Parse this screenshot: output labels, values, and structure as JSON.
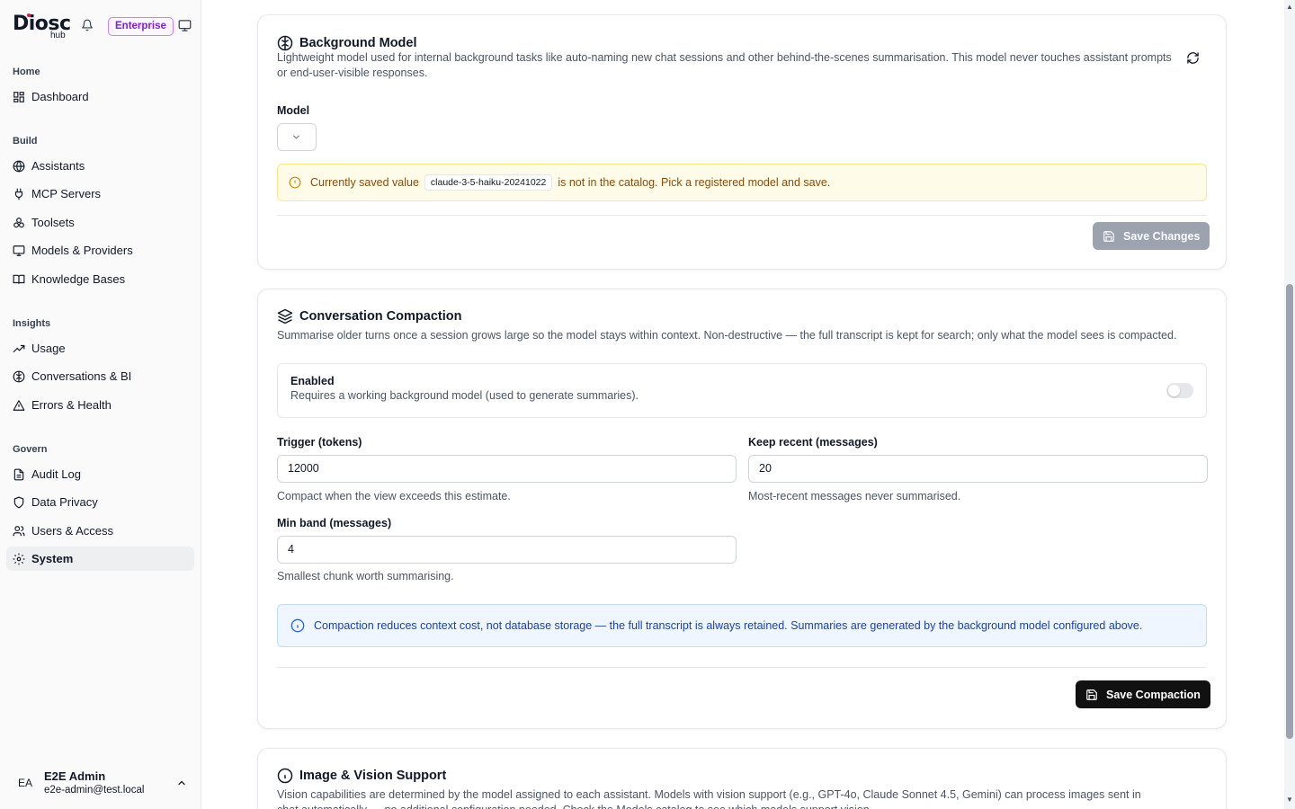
{
  "brand": {
    "name": "Diosc",
    "sub": "hub",
    "badge": "Enterprise"
  },
  "nav": {
    "groups": [
      "Home",
      "Build",
      "Insights",
      "Govern"
    ],
    "items": [
      {
        "label": "Dashboard",
        "icon": "dashboard-icon"
      },
      {
        "label": "Assistants",
        "icon": "globe-icon"
      },
      {
        "label": "MCP Servers",
        "icon": "plug-icon"
      },
      {
        "label": "Toolsets",
        "icon": "tools-icon"
      },
      {
        "label": "Models & Providers",
        "icon": "monitor-icon"
      },
      {
        "label": "Knowledge Bases",
        "icon": "book-icon"
      },
      {
        "label": "Usage",
        "icon": "trend-icon"
      },
      {
        "label": "Conversations & BI",
        "icon": "brain-icon"
      },
      {
        "label": "Errors & Health",
        "icon": "warning-icon"
      },
      {
        "label": "Audit Log",
        "icon": "file-icon"
      },
      {
        "label": "Data Privacy",
        "icon": "shield-icon"
      },
      {
        "label": "Users & Access",
        "icon": "users-icon"
      },
      {
        "label": "System",
        "icon": "gear-icon"
      }
    ]
  },
  "user": {
    "initials": "EA",
    "name": "E2E Admin",
    "email": "e2e-admin@test.local"
  },
  "background_model": {
    "title": "Background Model",
    "description": "Lightweight model used for internal background tasks like auto-naming new chat sessions and other behind-the-scenes summarisation. This model never touches assistant prompts or end-user-visible responses.",
    "model_label": "Model",
    "warning_prefix": "Currently saved value",
    "warning_code": "claude-3-5-haiku-20241022",
    "warning_suffix": "is not in the catalog. Pick a registered model and save.",
    "save_label": "Save Changes"
  },
  "compaction": {
    "title": "Conversation Compaction",
    "description": "Summarise older turns once a session grows large so the model stays within context. Non-destructive — the full transcript is kept for search; only what the model sees is compacted.",
    "enabled_label": "Enabled",
    "enabled_help": "Requires a working background model (used to generate summaries).",
    "enabled": false,
    "trigger_label": "Trigger (tokens)",
    "trigger_value": "12000",
    "trigger_help": "Compact when the view exceeds this estimate.",
    "keep_label": "Keep recent (messages)",
    "keep_value": "20",
    "keep_help": "Most-recent messages never summarised.",
    "band_label": "Min band (messages)",
    "band_value": "4",
    "band_help": "Smallest chunk worth summarising.",
    "info": "Compaction reduces context cost, not database storage — the full transcript is always retained. Summaries are generated by the background model configured above.",
    "save_label": "Save Compaction"
  },
  "vision": {
    "title": "Image & Vision Support",
    "description": "Vision capabilities are determined by the model assigned to each assistant. Models with vision support (e.g., GPT-4o, Claude Sonnet 4.5, Gemini) can process images sent in chat automatically — no additional configuration needed. Check the Models catalog to see which models support vision."
  }
}
